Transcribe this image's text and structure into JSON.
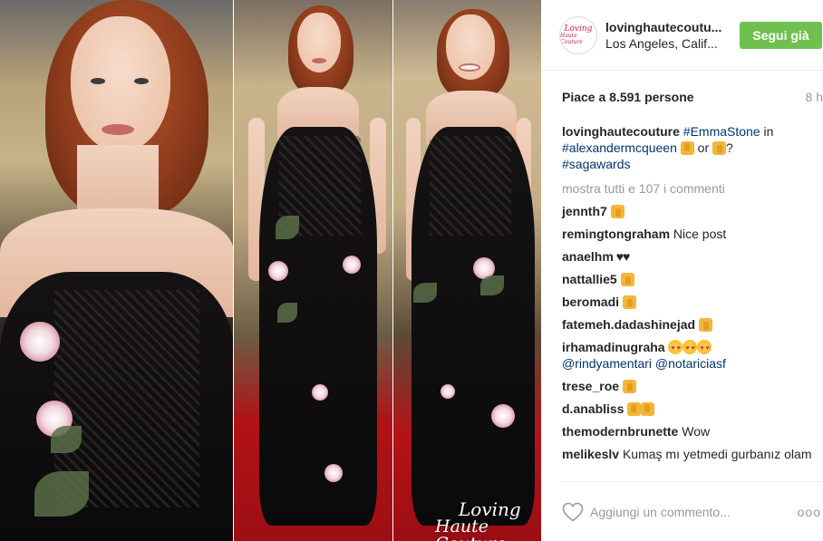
{
  "post": {
    "username": "lovinghautecoutu...",
    "location": "Los Angeles, Calif...",
    "follow_label": "Segui già",
    "avatar_text_line1": "Loving",
    "avatar_text_line2": "Haute Couture",
    "likes": "Piace a 8.591 persone",
    "time": "8 h",
    "watermark_line1": "Loving",
    "watermark_line2": "Haute Couture"
  },
  "caption": {
    "user": "lovinghautecouture",
    "tag1": "#EmmaStone",
    "text1": " in",
    "tag2": "#alexandermcqueen",
    "text2": " or ",
    "text3": "?",
    "tag3": "#sagawards"
  },
  "show_all": "mostra tutti e 107 i commenti",
  "comments": [
    {
      "user": "jennth7",
      "text": ""
    },
    {
      "user": "remingtongraham",
      "text": " Nice post"
    },
    {
      "user": "anaelhm",
      "text": " ♥♥"
    },
    {
      "user": "nattallie5",
      "text": ""
    },
    {
      "user": "beromadi",
      "text": ""
    },
    {
      "user": "fatemeh.dadashinejad",
      "text": ""
    },
    {
      "user": "irhamadinugraha",
      "text": "",
      "mention1": "@rindyamentari",
      "mention2": "@notariciasf"
    },
    {
      "user": "trese_roe",
      "text": ""
    },
    {
      "user": "d.anabliss",
      "text": ""
    },
    {
      "user": "themodernbrunette",
      "text": " Wow"
    },
    {
      "user": "melikeslv",
      "text": " Kumaş mı yetmedi gurbanız olam"
    }
  ],
  "footer": {
    "comment_placeholder": "Aggiungi un commento...",
    "more_label": "ooo"
  }
}
